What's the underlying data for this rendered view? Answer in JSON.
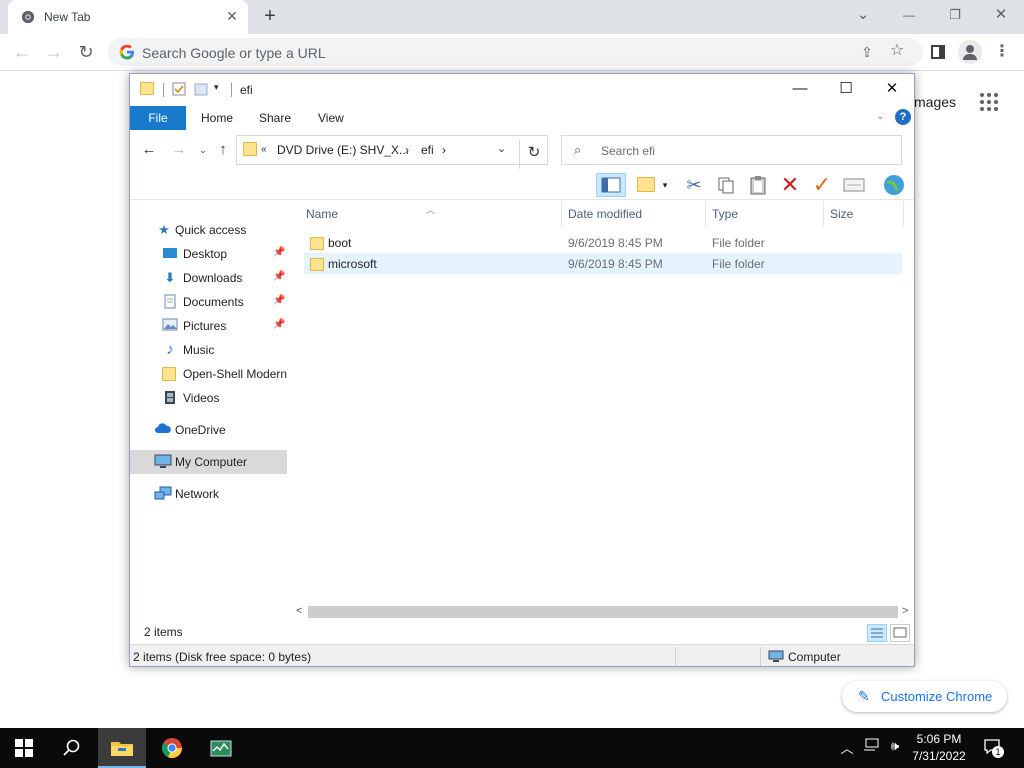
{
  "browser": {
    "tab_title": "New Tab",
    "tab_close": "✕",
    "new_tab": "+",
    "window_controls": {
      "tab_search": "⌄",
      "minimize": "—",
      "restore": "❐",
      "close": "✕"
    },
    "omnibox_placeholder": "Search Google or type a URL",
    "ntp_images_link": "mages",
    "customize_label": "Customize Chrome"
  },
  "explorer": {
    "title": "efi",
    "ribbon_tabs": {
      "file": "File",
      "home": "Home",
      "share": "Share",
      "view": "View"
    },
    "help": "?",
    "breadcrumb": {
      "overflow": "«",
      "drive": "DVD Drive (E:) SHV_X...",
      "sep1": "›",
      "folder": "efi",
      "sep2": "›"
    },
    "search_placeholder": "Search efi",
    "nav": {
      "quick_access": "Quick access",
      "desktop": "Desktop",
      "downloads": "Downloads",
      "documents": "Documents",
      "pictures": "Pictures",
      "music": "Music",
      "open_shell": "Open-Shell Modern",
      "videos": "Videos",
      "onedrive": "OneDrive",
      "my_computer": "My Computer",
      "network": "Network"
    },
    "columns": {
      "name": "Name",
      "date": "Date modified",
      "type": "Type",
      "size": "Size"
    },
    "files": [
      {
        "name": "boot",
        "date": "9/6/2019 8:45 PM",
        "type": "File folder"
      },
      {
        "name": "microsoft",
        "date": "9/6/2019 8:45 PM",
        "type": "File folder"
      }
    ],
    "item_count": "2 items",
    "status_detail": "2 items (Disk free space: 0 bytes)",
    "status_location": "Computer"
  },
  "taskbar": {
    "time": "5:06 PM",
    "date": "7/31/2022",
    "notification_count": "1"
  },
  "colors": {
    "chrome_tabbar": "#dee1e6",
    "ribbon_file": "#1979ca",
    "selected_row": "#e5f3ff",
    "folder_yellow": "#ffe38f",
    "link_blue": "#1a73e8"
  }
}
